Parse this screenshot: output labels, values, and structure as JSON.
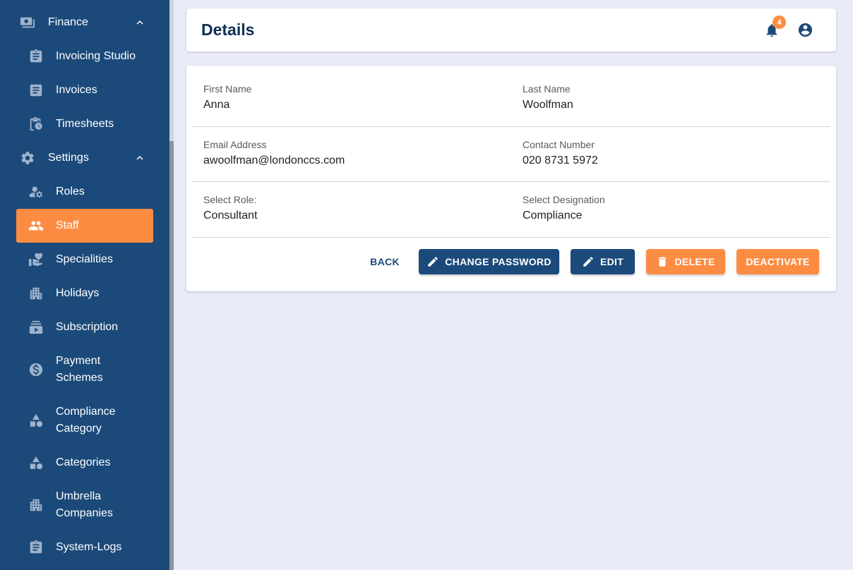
{
  "sidebar": {
    "items": [
      {
        "label": "Finance",
        "icon": "money-icon"
      },
      {
        "label": "Invoicing Studio",
        "icon": "clipboard-icon"
      },
      {
        "label": "Invoices",
        "icon": "invoice-icon"
      },
      {
        "label": "Timesheets",
        "icon": "timesheet-clock-icon"
      },
      {
        "label": "Settings",
        "icon": "gear-icon"
      },
      {
        "label": "Roles",
        "icon": "user-gear-icon"
      },
      {
        "label": "Staff",
        "icon": "people-icon"
      },
      {
        "label": "Specialities",
        "icon": "hand-heart-icon"
      },
      {
        "label": "Holidays",
        "icon": "building-icon"
      },
      {
        "label": "Subscription",
        "icon": "subscriptions-icon"
      },
      {
        "label": "Payment\nSchemes",
        "icon": "dollar-circle-icon"
      },
      {
        "label": "Compliance\nCategory",
        "icon": "shapes-icon"
      },
      {
        "label": "Categories",
        "icon": "shapes-icon"
      },
      {
        "label": "Umbrella\nCompanies",
        "icon": "apartment-icon"
      },
      {
        "label": "System-Logs",
        "icon": "clipboard-icon"
      }
    ]
  },
  "header": {
    "title": "Details",
    "notification_count": "4"
  },
  "details": {
    "first_name_label": "First Name",
    "first_name": "Anna",
    "last_name_label": "Last Name",
    "last_name": "Woolfman",
    "email_label": "Email Address",
    "email": "awoolfman@londonccs.com",
    "contact_label": "Contact Number",
    "contact": "020 8731 5972",
    "role_label": "Select Role:",
    "role": "Consultant",
    "designation_label": "Select Designation",
    "designation": "Compliance"
  },
  "actions": {
    "back": "BACK",
    "change_password": "CHANGE PASSWORD",
    "edit": "EDIT",
    "delete": "DELETE",
    "deactivate": "DEACTIVATE"
  },
  "colors": {
    "sidebar_bg": "#1b4a7a",
    "accent": "#fd8c43",
    "primary": "#1b4a7a",
    "page_bg": "#e9ebf8"
  }
}
